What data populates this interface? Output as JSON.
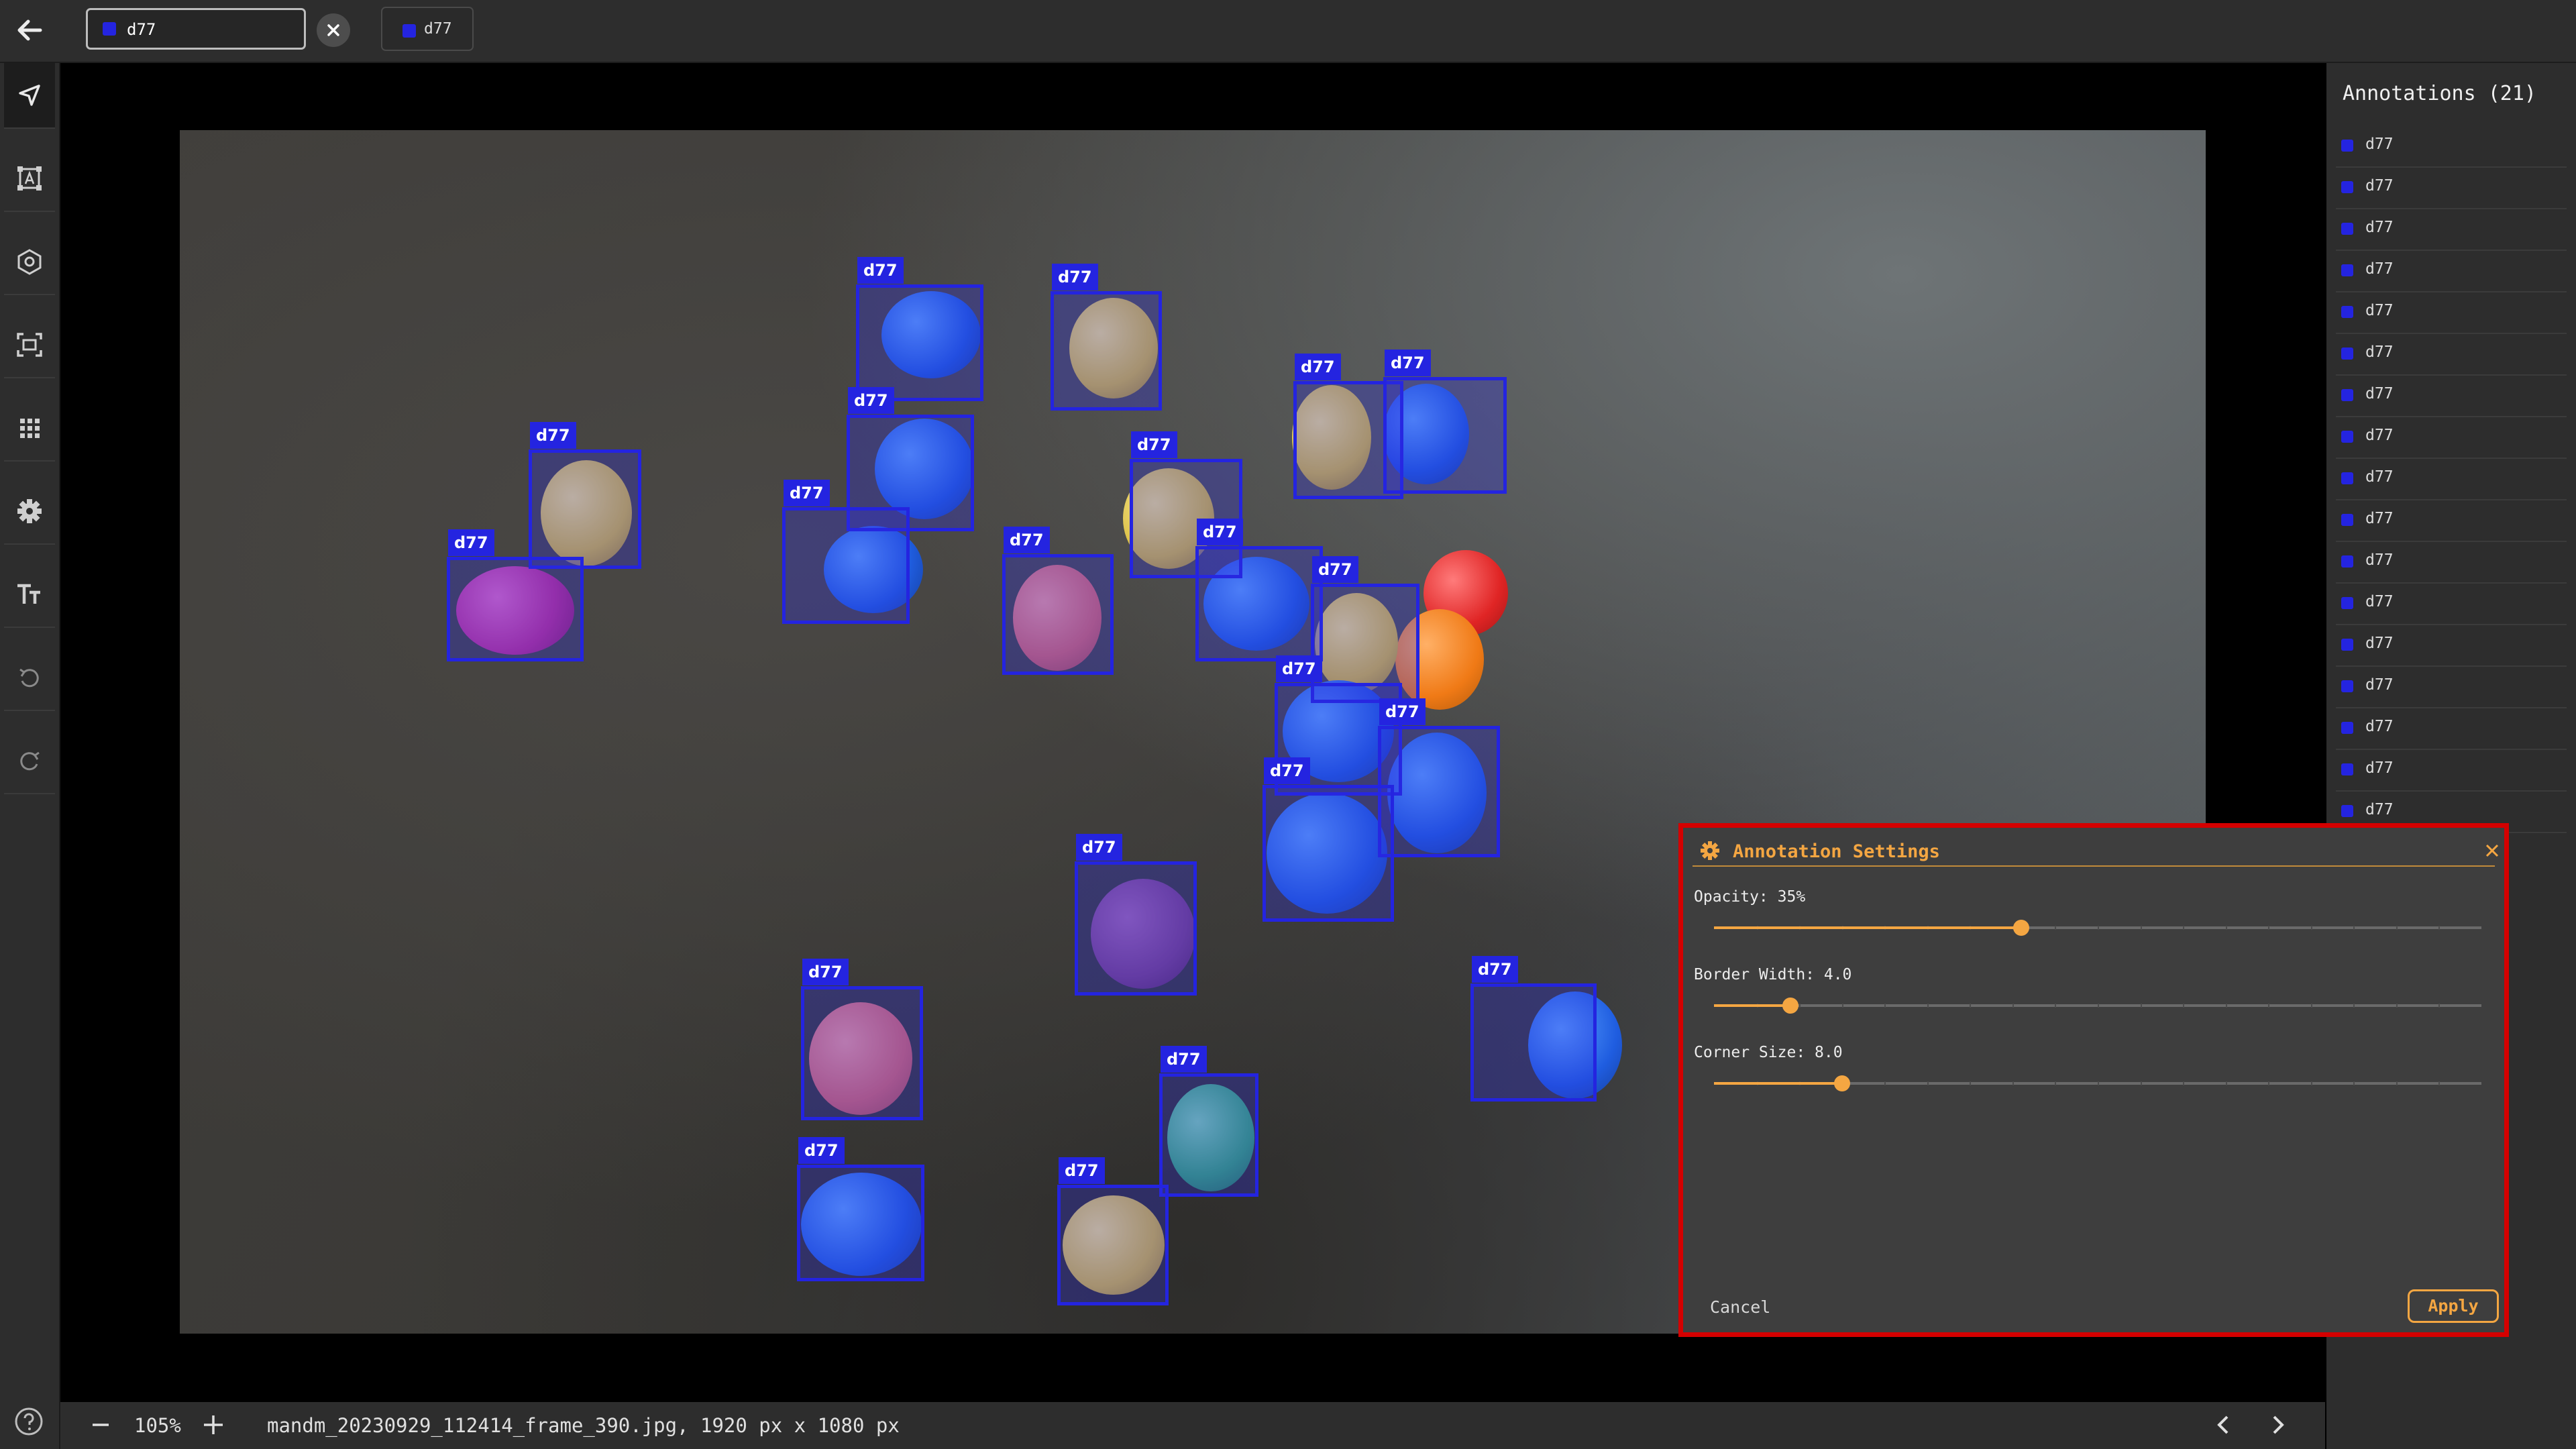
{
  "topbar": {
    "label_input_value": "d77",
    "label_chip_text": "d77",
    "label_color": "#2424e0"
  },
  "toolbar": {
    "tools": [
      "navigate-icon",
      "annotate-box-icon",
      "polygon-icon",
      "focus-icon",
      "grid-icon",
      "settings-gear-icon",
      "text-size-icon",
      "undo-icon",
      "redo-icon"
    ],
    "active_tool": "navigate-icon"
  },
  "canvas": {
    "annotation_label": "d77",
    "annotation_color": "#2424e0",
    "annotation_opacity": 0.35
  },
  "side_panel": {
    "title": "Annotations (21)",
    "visible_items": [
      "d77",
      "d77",
      "d77",
      "d77",
      "d77",
      "d77",
      "d77",
      "d77",
      "d77",
      "d77",
      "d77",
      "d77",
      "d77",
      "d77",
      "d77",
      "d77",
      "d77"
    ]
  },
  "status_bar": {
    "zoom": "105%",
    "file_info": "mandm_20230929_112414_frame_390.jpg, 1920 px x 1080 px"
  },
  "settings_dialog": {
    "title": "Annotation Settings",
    "opacity_label": "Opacity: 35%",
    "opacity_value": 0.4,
    "border_width_label": "Border Width: 4.0",
    "border_width_value": 0.1,
    "corner_size_label": "Corner Size: 8.0",
    "corner_size_value": 0.167,
    "cancel_label": "Cancel",
    "apply_label": "Apply",
    "accent_color": "#f4a642",
    "frame_color": "#d40000"
  }
}
